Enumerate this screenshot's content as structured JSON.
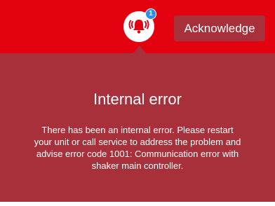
{
  "colors": {
    "top_bar": "#e3000f",
    "panel": "#a7303a",
    "badge": "#2f8fe0",
    "text": "#ffffff"
  },
  "header": {
    "alarm_icon": "ringing-bell-icon",
    "notification_count": "1",
    "acknowledge_label": "Acknowledge"
  },
  "alert": {
    "title": "Internal error",
    "message": "There has been an internal error. Please restart your unit or call service to address the problem and advise error code 1001: Communication error with shaker main controller."
  }
}
